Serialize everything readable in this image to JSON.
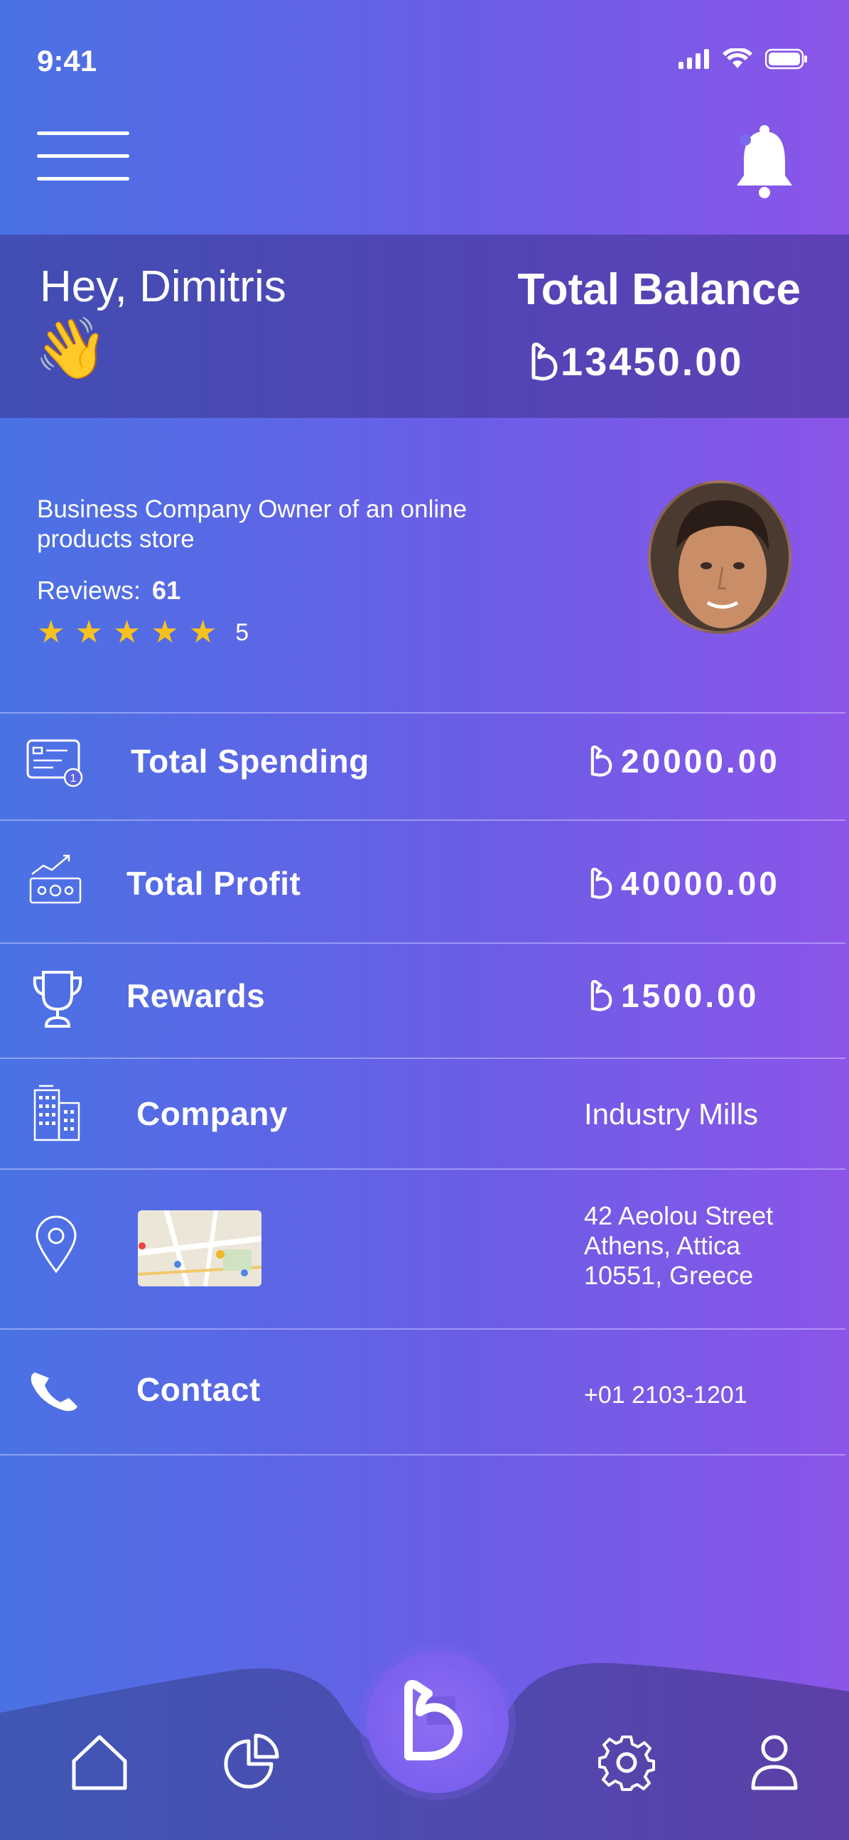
{
  "status": {
    "time": "9:41"
  },
  "header": {
    "greeting": "Hey, Dimitris",
    "wave_emoji": "👋",
    "balance_label": "Total Balance",
    "balance_value": "13450.00"
  },
  "profile": {
    "description": "Business Company Owner of an online products store",
    "reviews_label": "Reviews:",
    "reviews_count": "61",
    "rating": "5",
    "stars": 5
  },
  "rows": {
    "spending": {
      "label": "Total Spending",
      "value": "20000.00",
      "icon": "card-icon"
    },
    "profit": {
      "label": "Total Profit",
      "value": "40000.00",
      "icon": "cash-growth-icon"
    },
    "rewards": {
      "label": "Rewards",
      "value": "1500.00",
      "icon": "trophy-icon"
    },
    "company": {
      "label": "Company",
      "value": "Industry Mills",
      "icon": "building-icon"
    },
    "address": {
      "line1": "42 Aeolou Street",
      "line2": "Athens, Attica",
      "line3": "10551, Greece",
      "icon": "location-pin-icon"
    },
    "contact": {
      "label": "Contact",
      "value": "+01 2103-1201",
      "icon": "phone-icon"
    }
  },
  "nav": {
    "items": [
      "home-icon",
      "chart-pie-icon",
      "brand-logo-icon",
      "settings-icon",
      "user-icon"
    ]
  },
  "colors": {
    "gradient_start": "#4a72e4",
    "gradient_end": "#8b55e8",
    "star": "#f8c21e",
    "band": "#3c328c"
  }
}
